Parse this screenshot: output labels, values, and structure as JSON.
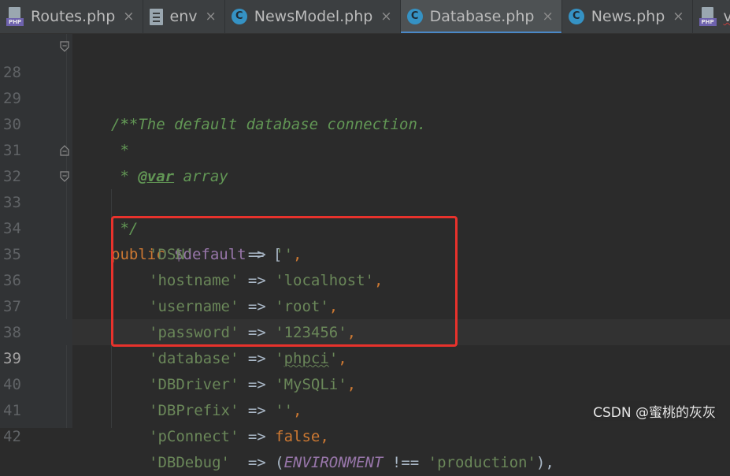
{
  "tabs": [
    {
      "label": "Routes.php",
      "icon": "php-file-icon",
      "active": false,
      "close": "×"
    },
    {
      "label": "env",
      "icon": "text-file-icon",
      "active": false,
      "close": "×"
    },
    {
      "label": "NewsModel.php",
      "icon": "php-class-icon",
      "active": false,
      "close": "×"
    },
    {
      "label": "Database.php",
      "icon": "php-class-icon",
      "active": true,
      "close": "×"
    },
    {
      "label": "News.php",
      "icon": "php-class-icon",
      "active": false,
      "close": "×"
    },
    {
      "label": "view.",
      "icon": "php-file-icon",
      "active": false,
      "close": ""
    }
  ],
  "php_icon_label": "PHP",
  "class_icon_letter": "C",
  "editor": {
    "current_line": "39",
    "lines": [
      {
        "num": "28",
        "p": "/**"
      },
      {
        "num": "29",
        "p": " * The default database connection."
      },
      {
        "num": "30",
        "p": " *"
      },
      {
        "num": "31",
        "a": " * ",
        "b": "@var",
        "c": " array"
      },
      {
        "num": "32",
        "p": " */"
      },
      {
        "num": "33",
        "a": "public ",
        "b": "$default",
        "c": " = ["
      },
      {
        "num": "34",
        "a": "'DSN'",
        "b": "      => ",
        "c": "''",
        "d": ","
      },
      {
        "num": "35",
        "a": "'hostname'",
        "b": " => ",
        "c": "'localhost'",
        "d": ","
      },
      {
        "num": "36",
        "a": "'username'",
        "b": " => ",
        "c": "'root'",
        "d": ","
      },
      {
        "num": "37",
        "a": "'password'",
        "b": " => ",
        "c": "'123456'",
        "d": ","
      },
      {
        "num": "38",
        "a": "'database'",
        "b": " => ",
        "c1": "'",
        "c2": "phpci",
        "c3": "'",
        "d": ","
      },
      {
        "num": "39",
        "a": "'DBDriver'",
        "b": " => ",
        "c": "'MySQLi'",
        "d": ","
      },
      {
        "num": "40",
        "a": "'DBPrefix'",
        "b": " => ",
        "c": "''",
        "d": ","
      },
      {
        "num": "41",
        "a": "'pConnect'",
        "b": " => ",
        "c": "false",
        "d": ","
      },
      {
        "num": "42",
        "a": "'DBDebug'",
        "b": "  => (",
        "c": "ENVIRONMENT",
        "d": " !== ",
        "e": "'production'",
        "f": "),"
      }
    ]
  },
  "watermark": "CSDN @蜜桃的灰灰",
  "colors": {
    "highlight_box": "#e8322c",
    "active_tab_underline": "#4a88c7"
  }
}
